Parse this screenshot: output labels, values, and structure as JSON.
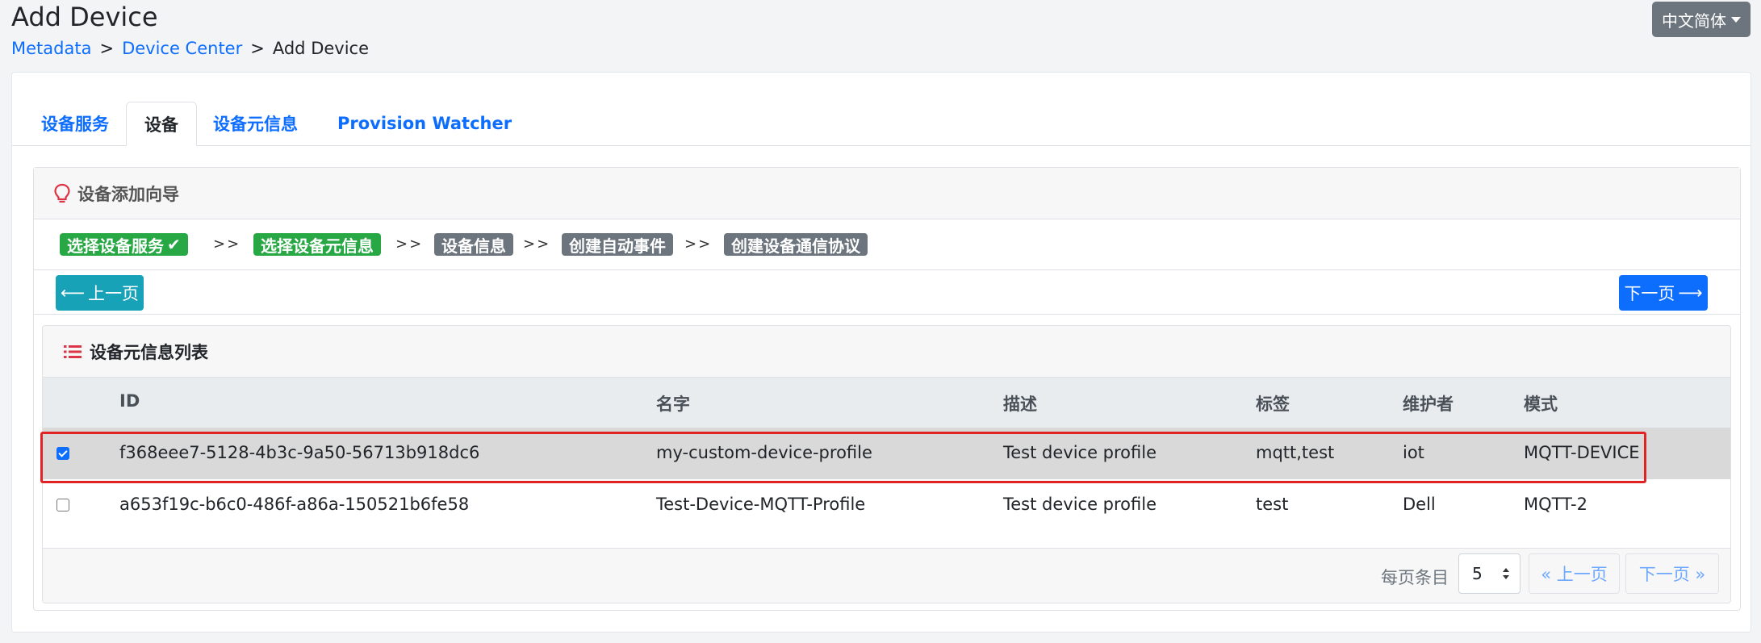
{
  "header": {
    "title": "Add Device",
    "breadcrumb": [
      {
        "label": "Metadata"
      },
      {
        "label": "Device Center"
      },
      {
        "label": "Add Device"
      }
    ],
    "breadcrumb_separator": ">",
    "language": "中文简体"
  },
  "tabs": [
    {
      "label": "设备服务"
    },
    {
      "label": "设备"
    },
    {
      "label": "设备元信息"
    },
    {
      "label": "Provision Watcher"
    }
  ],
  "wizard": {
    "title": "设备添加向导",
    "steps": [
      {
        "label": "选择设备服务",
        "status": "done",
        "check": "✔"
      },
      {
        "label": "选择设备元信息",
        "status": "done"
      },
      {
        "label": "设备信息",
        "status": "pending"
      },
      {
        "label": "创建自动事件",
        "status": "pending"
      },
      {
        "label": "创建设备通信协议",
        "status": "pending"
      }
    ],
    "step_separator": ">>",
    "prev_button": "上一页",
    "next_button": "下一页",
    "arrow_left": "⟵",
    "arrow_right": "⟶"
  },
  "profile_list": {
    "title": "设备元信息列表",
    "columns": [
      "ID",
      "名字",
      "描述",
      "标签",
      "维护者",
      "模式"
    ],
    "rows": [
      {
        "checked": true,
        "id": "f368eee7-5128-4b3c-9a50-56713b918dc6",
        "name": "my-custom-device-profile",
        "description": "Test device profile",
        "labels": "mqtt,test",
        "manufacturer": "iot",
        "model": "MQTT-DEVICE"
      },
      {
        "checked": false,
        "id": "a653f19c-b6c0-486f-a86a-150521b6fe58",
        "name": "Test-Device-MQTT-Profile",
        "description": "Test device profile",
        "labels": "test",
        "manufacturer": "Dell",
        "model": "MQTT-2"
      }
    ],
    "per_page_label": "每页条目",
    "per_page_value": "5",
    "prev_page": "« 上一页",
    "next_page": "下一页 »"
  },
  "colors": {
    "link": "#0d6efd",
    "step_done": "#28a745",
    "step_pending": "#6c757d",
    "prev_btn": "#17a2b8",
    "next_btn": "#0d6efd",
    "highlight": "#e02424",
    "bulb_icon": "#dc3545"
  },
  "icons": [
    "lightbulb-icon",
    "list-icon",
    "check-icon",
    "arrow-left-icon",
    "arrow-right-icon",
    "caret-down-icon",
    "select-arrows-icon"
  ]
}
